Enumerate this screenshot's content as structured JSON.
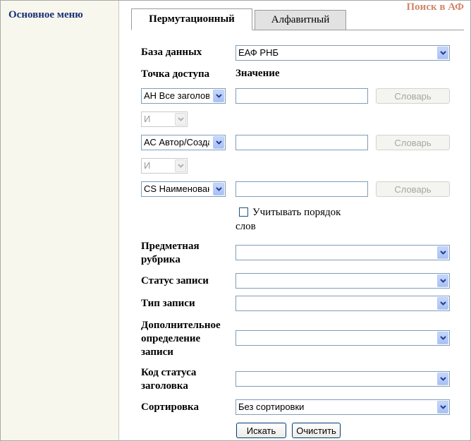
{
  "sidebar": {
    "title": "Основное меню"
  },
  "header": {
    "title": "Поиск в АФ"
  },
  "tabs": [
    {
      "label": "Пермутационный",
      "active": true
    },
    {
      "label": "Алфавитный",
      "active": false
    }
  ],
  "form": {
    "database": {
      "label": "База данных",
      "value": "ЕАФ РНБ"
    },
    "access_point_header": "Точка доступа",
    "value_header": "Значение",
    "rows": [
      {
        "field": "АН Все заголов",
        "value": "",
        "button": "Словарь"
      },
      {
        "field": "АС Автор/Созда",
        "value": "",
        "button": "Словарь"
      },
      {
        "field": "CS Наименован",
        "value": "",
        "button": "Словарь"
      }
    ],
    "operators": [
      "И",
      "И"
    ],
    "word_order": {
      "label_line1": "Учитывать порядок",
      "label_line2": "слов",
      "checked": false
    },
    "subject_heading": {
      "label_line1": "Предметная",
      "label_line2": "рубрика",
      "value": ""
    },
    "record_status": {
      "label": "Статус записи",
      "value": ""
    },
    "record_type": {
      "label": "Тип записи",
      "value": ""
    },
    "extra_definition": {
      "label_line1": "Дополнительное",
      "label_line2": "определение",
      "label_line3": "записи",
      "value": ""
    },
    "heading_status_code": {
      "label_line1": "Код статуса",
      "label_line2": "заголовка",
      "value": ""
    },
    "sorting": {
      "label": "Сортировка",
      "value": "Без сортировки"
    }
  },
  "actions": {
    "search": "Искать",
    "clear": "Очистить"
  },
  "colors": {
    "sidebar_bg": "#f7f7ed",
    "sidebar_title": "#1a2f77",
    "page_title": "#d2856a",
    "select_border": "#7f9db9"
  },
  "icons": {
    "dropdown": "chevron-down-icon"
  }
}
